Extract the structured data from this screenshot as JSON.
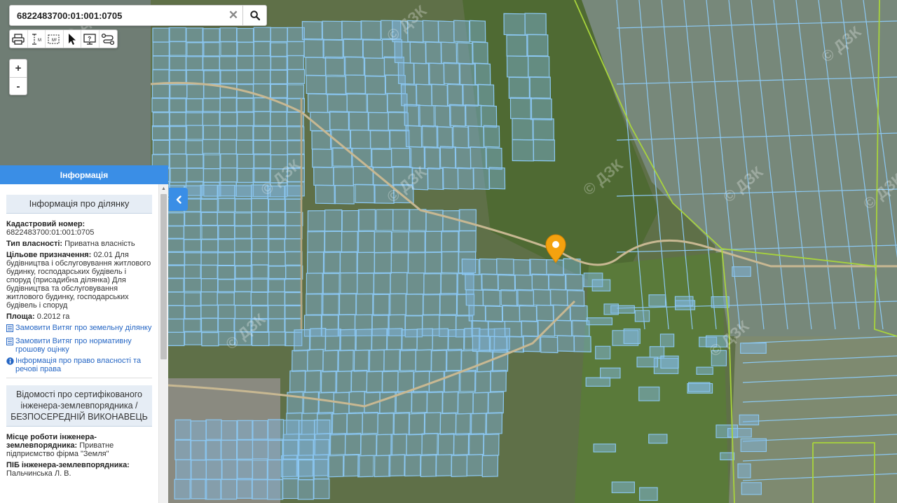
{
  "search": {
    "value": "6822483700:01:001:0705",
    "placeholder": "Кадастровий номер"
  },
  "toolbar": {
    "tools": [
      "printer-icon",
      "measure-line-icon",
      "measure-area-icon",
      "pointer-icon",
      "identify-icon",
      "route-icon"
    ]
  },
  "zoom": {
    "in_label": "+",
    "out_label": "-"
  },
  "watermark": "© ДЗК",
  "panel": {
    "header": "Інформація",
    "parcel_section": {
      "title": "Інформація про ділянку",
      "cadastral_label": "Кадастровий номер:",
      "cadastral_value": "6822483700:01:001:0705",
      "ownership_label": "Тип власності:",
      "ownership_value": "Приватна власність",
      "purpose_label": "Цільове призначення:",
      "purpose_value": "02.01 Для будівництва і обслуговування житлового будинку, господарських будівель і споруд (присадибна ділянка) Для будівництва та обслуговування житлового будинку, господарських будівель і споруд",
      "area_label": "Площа:",
      "area_value": "0.2012 га",
      "link_extract": "Замовити Витяг про земельну ділянку",
      "link_valuation": "Замовити Витяг про нормативну грошову оцінку",
      "link_rights": "Інформація про право власності та речові права"
    },
    "engineer_section": {
      "title": "Відомості про сертифікованого інженера-землевпорядника / БЕЗПОСЕРЕДНІЙ ВИКОНАВЕЦЬ",
      "workplace_label": "Місце роботи інженера-землевпорядника:",
      "workplace_value": "Приватне підприємство фірма \"Земля\"",
      "name_label": "ПІБ інженера-землевпорядника:",
      "name_value": "Пальчинська Л. В."
    }
  },
  "colors": {
    "accent": "#3a8ee6",
    "parcel_stroke": "#8cc8f2",
    "parcel_fill": "#7fb6e0",
    "boundary": "#a8d43c",
    "marker": "#f4a20f"
  }
}
